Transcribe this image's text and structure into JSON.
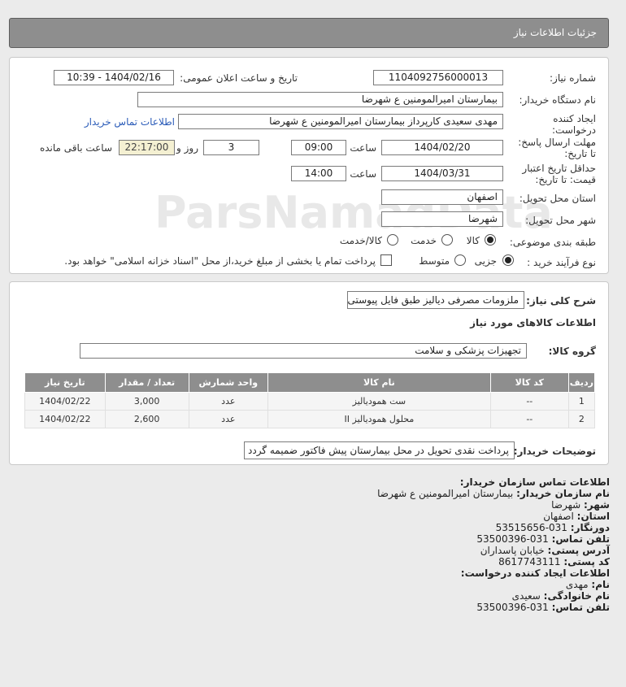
{
  "header": {
    "title": "جزئیات اطلاعات نیاز"
  },
  "form": {
    "need_number_label": "شماره نیاز:",
    "need_number": "1104092756000013",
    "announce_datetime_label": "تاریخ و ساعت اعلان عمومی:",
    "announce_datetime": "1404/02/16 - 10:39",
    "buyer_org_label": "نام دستگاه خریدار:",
    "buyer_org": "بیمارستان امیرالمومنین ع  شهرضا",
    "requester_label_1": "ایجاد کننده",
    "requester_label_2": "درخواست:",
    "requester": "مهدی سعیدی کارپرداز بیمارستان امیرالمومنین ع  شهرضا",
    "buyer_contact_link": "اطلاعات تماس خریدار",
    "reply_deadline_label_1": "مهلت ارسال پاسخ:",
    "reply_deadline_label_2": "تا تاریخ:",
    "reply_date": "1404/02/20",
    "time_label": "ساعت",
    "reply_time": "09:00",
    "days": "3",
    "days_label": "روز و",
    "remaining": "22:17:00",
    "remaining_label": "ساعت باقی مانده",
    "validity_label_1": "حداقل تاریخ اعتبار",
    "validity_label_2": "قیمت: تا تاریخ:",
    "validity_date": "1404/03/31",
    "validity_time": "14:00",
    "province_label": "استان محل تحویل:",
    "province": "اصفهان",
    "city_label": "شهر محل تحویل:",
    "city": "شهرضا",
    "category_label": "طبقه بندی موضوعی:",
    "category_options": [
      "کالا",
      "خدمت",
      "کالا/خدمت"
    ],
    "process_label": "نوع فرآیند خرید :",
    "process_options": [
      "جزیی",
      "متوسط"
    ],
    "payment_note": "پرداخت تمام یا بخشی از مبلغ خرید،از محل \"اسناد خزانه اسلامی\" خواهد بود."
  },
  "details": {
    "summary_label": "شرح کلی نیاز:",
    "summary": "ملزومات مصرفی دیالیز طبق فایل پیوستی",
    "goods_info_title": "اطلاعات کالاهای مورد نیاز",
    "goods_group_label": "گروه کالا:",
    "goods_group": "تجهیزات پزشکی و سلامت",
    "table_headers": [
      "ردیف",
      "کد کالا",
      "نام کالا",
      "واحد شمارش",
      "تعداد / مقدار",
      "تاریخ نیاز"
    ],
    "rows": [
      [
        "1",
        "--",
        "ست همودیالیز",
        "عدد",
        "3,000",
        "1404/02/22"
      ],
      [
        "2",
        "--",
        "محلول همودیالیز II",
        "عدد",
        "2,600",
        "1404/02/22"
      ]
    ],
    "buyer_notes_label": "توضیحات خریدار:",
    "buyer_notes": "پرداخت نقدی تحویل در محل بیمارستان پیش فاکتور ضمیمه گردد"
  },
  "contact": {
    "org_title": "اطلاعات تماس سازمان خریدار:",
    "org_name_label": "نام سازمان خریدار:",
    "org_name": "بیمارستان امیرالمومنین ع شهرضا",
    "city_label": "شهر:",
    "city": "شهرضا",
    "province_label": "استان:",
    "province": "اصفهان",
    "fax_label": "دورنگار:",
    "fax": "031-53515656",
    "phone_label": "تلفن تماس:",
    "phone": "031-53500396",
    "address_label": "آدرس پستی:",
    "address": "خیابان پاسداران",
    "postal_label": "کد پستی:",
    "postal": "8617743111",
    "creator_title": "اطلاعات ایجاد کننده درخواست:",
    "first_name_label": "نام:",
    "first_name": "مهدی",
    "last_name_label": "نام خانوادگی:",
    "last_name": "سعیدی",
    "creator_phone_label": "تلفن تماس:",
    "creator_phone": "031-53500396"
  },
  "watermark": "ParsNamadData"
}
